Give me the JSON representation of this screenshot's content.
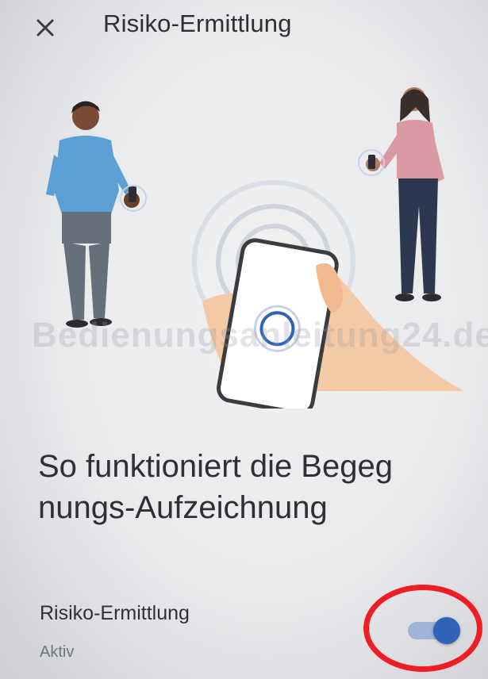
{
  "header": {
    "close_icon": "close-icon",
    "title": "Risiko-Ermittlung"
  },
  "watermark": "Bedienungsanleitung24.de",
  "main": {
    "headline_line1": "So funktioniert die Begeg",
    "headline_line2": "nungs-Aufzeichnung"
  },
  "setting": {
    "label": "Risiko-Ermittlung",
    "status": "Aktiv",
    "toggle_on": true
  },
  "colors": {
    "accent": "#2f62b8",
    "highlight": "#ee1e22"
  }
}
